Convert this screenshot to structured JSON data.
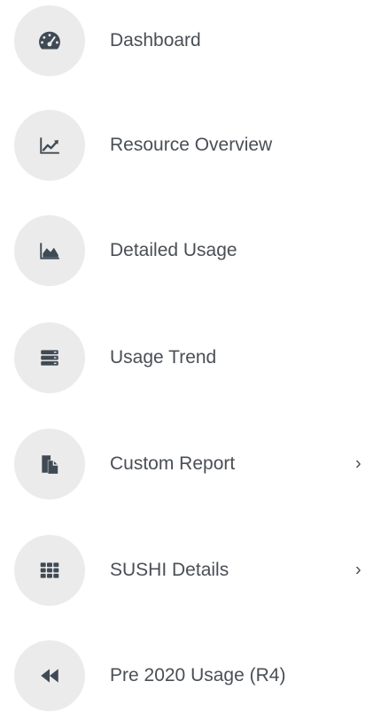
{
  "colors": {
    "icon": "#3f4a54",
    "circle_bg": "#ebebeb",
    "label": "#4a4f55"
  },
  "nav": {
    "items": [
      {
        "label": "Dashboard",
        "icon": "speedometer-icon"
      },
      {
        "label": "Resource Overview",
        "icon": "line-chart-icon"
      },
      {
        "label": "Detailed Usage",
        "icon": "area-chart-icon"
      },
      {
        "label": "Usage Trend",
        "icon": "server-stack-icon"
      },
      {
        "label": "Custom Report",
        "icon": "copy-document-icon",
        "chevron": "›"
      },
      {
        "label": "SUSHI Details",
        "icon": "grid-icon",
        "chevron": "›"
      },
      {
        "label": "Pre 2020 Usage (R4)",
        "icon": "backward-icon"
      }
    ]
  }
}
